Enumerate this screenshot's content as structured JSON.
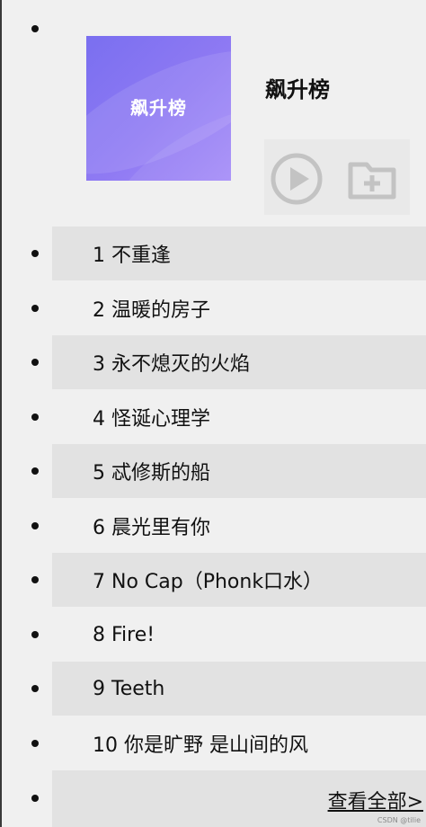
{
  "chart": {
    "cover_text": "飙升榜",
    "title": "飙升榜",
    "play_icon": "play-circle-icon",
    "collect_icon": "folder-add-icon"
  },
  "tracks": [
    {
      "rank": "1",
      "label": "1 不重逢"
    },
    {
      "rank": "2",
      "label": "2 温暖的房子"
    },
    {
      "rank": "3",
      "label": "3 永不熄灭的火焰"
    },
    {
      "rank": "4",
      "label": "4 怪诞心理学"
    },
    {
      "rank": "5",
      "label": "5 忒修斯的船"
    },
    {
      "rank": "6",
      "label": "6 晨光里有你"
    },
    {
      "rank": "7",
      "label": "7 No Cap（Phonk口水）"
    },
    {
      "rank": "8",
      "label": "8 Fire!"
    },
    {
      "rank": "9",
      "label": "9 Teeth"
    },
    {
      "rank": "10",
      "label": "10 你是旷野 是山间的风"
    }
  ],
  "footer": {
    "view_all": "查看全部>",
    "watermark": "CSDN @tilie"
  },
  "colors": {
    "background": "#f0f0f0",
    "alt_row": "#e2e2e2",
    "cover_gradient_start": "#7a6ff0",
    "cover_gradient_end": "#a58cf8"
  }
}
